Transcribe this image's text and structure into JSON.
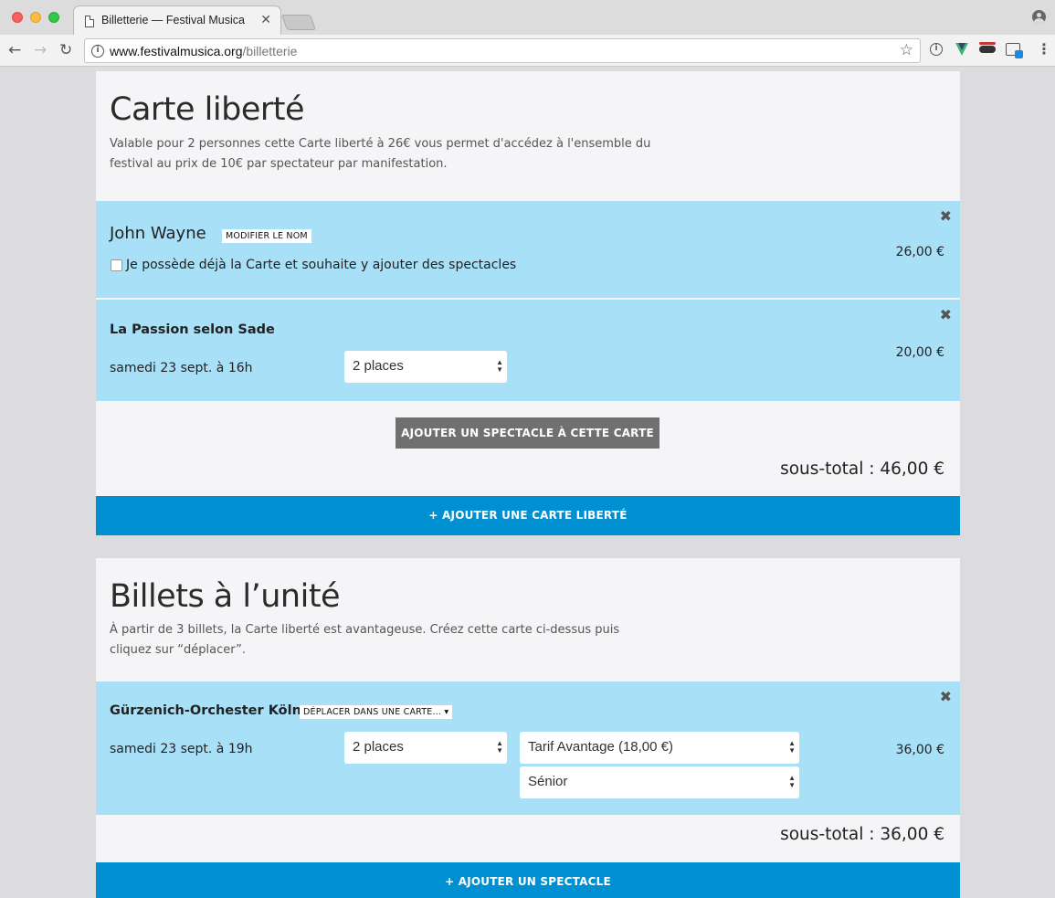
{
  "browser": {
    "tab_title": "Billetterie — Festival Musica",
    "tab_close": "✕",
    "url_host": "www.festivalmusica.org",
    "url_path": "/billetterie",
    "back": "←",
    "forward": "→",
    "reload": "↻",
    "star": "☆",
    "info": "i",
    "ext_info": "i",
    "menu": "⋮"
  },
  "carte": {
    "title": "Carte liberté",
    "description": "Valable pour 2 personnes cette Carte liberté à 26€ vous permet d'accédez à l'ensemble du festival au prix de 10€ par spectateur par manifestation.",
    "holder": {
      "name": "John Wayne",
      "modify_label": "MODIFIER LE NOM",
      "checkbox_label": "Je possède déjà la Carte et souhaite y ajouter des spectacles",
      "checked": false,
      "price": "26,00 €",
      "close": "✖"
    },
    "show": {
      "title": "La Passion selon Sade",
      "date": "samedi 23 sept. à 16h",
      "places": "2 places",
      "price": "20,00 €",
      "close": "✖"
    },
    "add_show_label": "AJOUTER UN SPECTACLE À CETTE CARTE",
    "subtotal": "sous-total : 46,00 €",
    "add_card_label": "+ AJOUTER UNE CARTE LIBERTÉ"
  },
  "billets": {
    "title": "Billets à l’unité",
    "description": "À partir de 3 billets, la Carte liberté est avantageuse. Créez cette carte ci-dessus puis cliquez sur “déplacer”.",
    "show": {
      "title": "Gürzenich-Orchester Köln",
      "move_label": "DÉPLACER DANS UNE CARTE...",
      "date": "samedi 23 sept. à 19h",
      "places": "2 places",
      "tarif": "Tarif Avantage (18,00 €)",
      "category": "Sénior",
      "price": "36,00 €",
      "close": "✖"
    },
    "subtotal": "sous-total : 36,00 €",
    "add_show_label": "+ AJOUTER UN SPECTACLE"
  },
  "colors": {
    "row_bg": "#a8e0f7",
    "primary_blue": "#008fd0",
    "dark_button": "#707070"
  }
}
